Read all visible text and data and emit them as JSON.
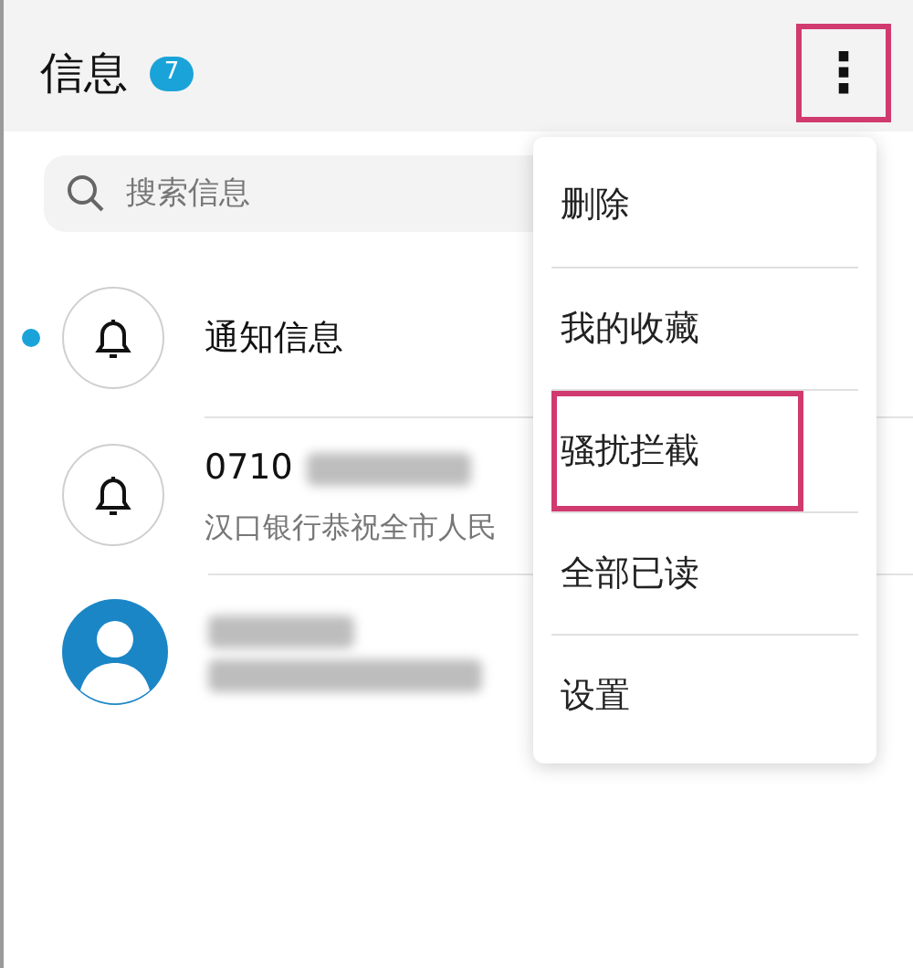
{
  "header": {
    "title": "信息",
    "badge": "7",
    "more_button": {
      "label": "⋮",
      "highlighted": true
    }
  },
  "search": {
    "placeholder": "搜索信息"
  },
  "conversations": [
    {
      "kind": "bell",
      "unread": true,
      "name": "通知信息",
      "name_redacted": false
    },
    {
      "kind": "bell",
      "unread": false,
      "name": "0710",
      "name_redacted": true,
      "preview": "汉口银行恭祝全市人民",
      "preview_redacted": false
    },
    {
      "kind": "person",
      "unread": false,
      "name_redacted": true,
      "preview_redacted": true
    }
  ],
  "menu": {
    "items": [
      {
        "label": "删除",
        "highlighted": false
      },
      {
        "label": "我的收藏",
        "highlighted": false
      },
      {
        "label": "骚扰拦截",
        "highlighted": true
      },
      {
        "label": "全部已读",
        "highlighted": false
      },
      {
        "label": "设置",
        "highlighted": false
      }
    ]
  }
}
